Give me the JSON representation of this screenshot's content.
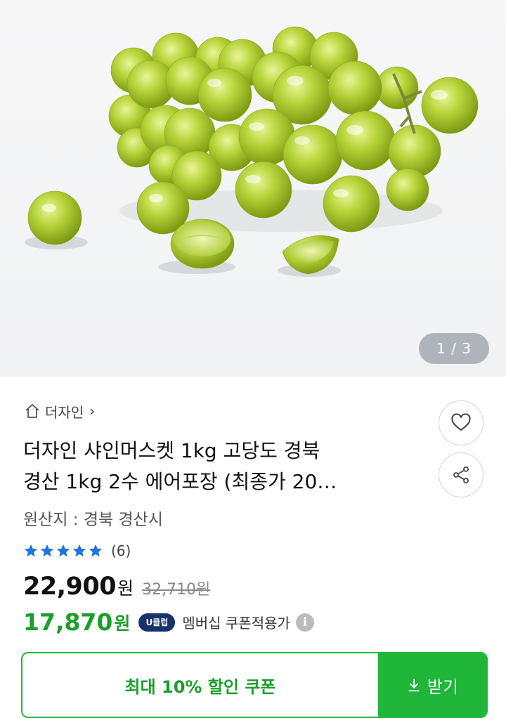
{
  "hero": {
    "image_alt": "샤인머스켓 포도 송이",
    "counter": "1 / 3",
    "icon": "grape-photo"
  },
  "seller": {
    "icon": "home-icon",
    "name": "더자인",
    "chevron": "›"
  },
  "product": {
    "title_line1": "더자인 샤인머스켓 1kg 고당도 경북",
    "title_line2": "경산 1kg 2수 에어포장 (최종가 20…",
    "origin": "원산지 : 경북 경산시",
    "rating_stars": 5,
    "review_count": "(6)"
  },
  "actions": {
    "like_icon": "heart-icon",
    "share_icon": "share-icon"
  },
  "price": {
    "sale": "22,900",
    "sale_unit": "원",
    "original": "32,710원",
    "member": "17,870",
    "member_unit": "원",
    "badge": "U클럽",
    "member_text": "멤버십 쿠폰적용가",
    "info_icon": "i"
  },
  "coupon": {
    "label": "최대 10% 할인 쿠폰",
    "button": "받기"
  },
  "colors": {
    "accent_green": "#1fb63a",
    "badge_navy": "#16336b",
    "star_blue": "#1e74e0"
  }
}
